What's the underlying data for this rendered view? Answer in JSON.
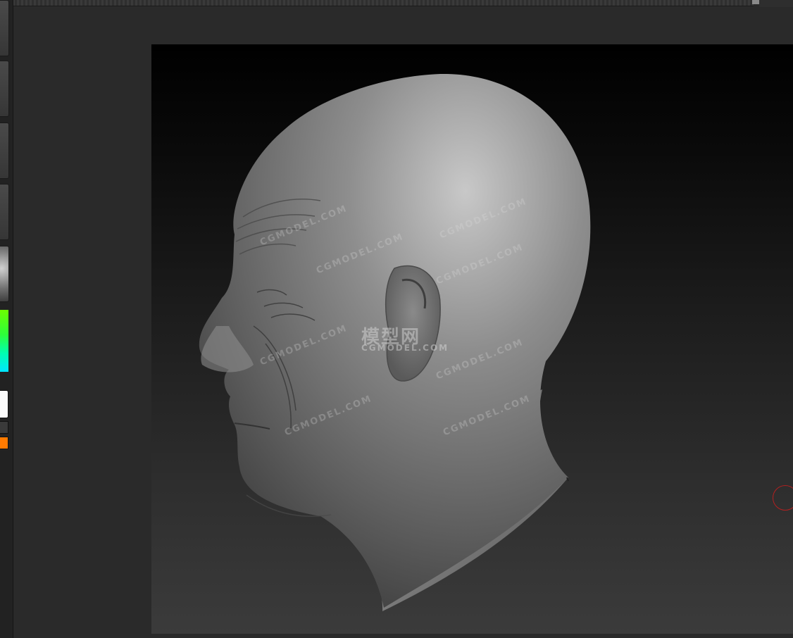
{
  "app": {
    "name": "ZBrush-style sculpting viewport"
  },
  "left_tray": {
    "items": [
      {
        "name": "brush-slot"
      },
      {
        "name": "stroke-slot"
      },
      {
        "name": "alpha-slot"
      },
      {
        "name": "texture-slot"
      },
      {
        "name": "material-slot"
      }
    ],
    "color_picker_colors": [
      "#6cff00",
      "#00e6ff"
    ],
    "main_color": "#fafafa",
    "secondary_color": "#3a3a3a",
    "accent_swatch": "#ff7a00"
  },
  "canvas": {
    "subject": "sculpted bald head, left profile",
    "background_colors": [
      "#000000",
      "#3b3b3b"
    ]
  },
  "watermarks": {
    "domain_text": "CGMODEL.COM",
    "logo_text": "模型网",
    "logo_sub": "CGMODEL.COM"
  },
  "cursor": {
    "color": "#b32020"
  }
}
